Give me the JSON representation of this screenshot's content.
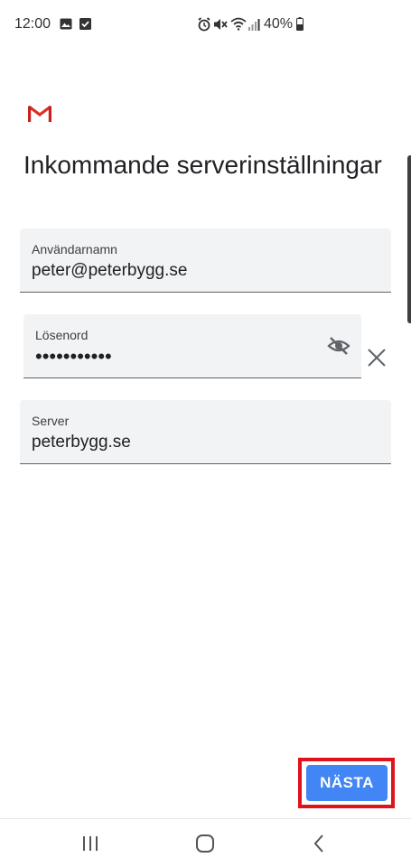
{
  "status_bar": {
    "time": "12:00",
    "battery": "40%",
    "left_icons": [
      "image-icon",
      "check-square-icon"
    ],
    "right_icons": [
      "alarm-icon",
      "mute-icon",
      "wifi-icon",
      "signal-icon",
      "battery-icon"
    ]
  },
  "app": {
    "logo": "gmail-logo",
    "title": "Inkommande serverinställningar"
  },
  "form": {
    "username": {
      "label": "Användarnamn",
      "value": "peter@peterbygg.se"
    },
    "password": {
      "label": "Lösenord",
      "value": "•••••••••••"
    },
    "server": {
      "label": "Server",
      "value": "peterbygg.se"
    }
  },
  "actions": {
    "next_label": "NÄSTA"
  },
  "colors": {
    "accent": "#4285f4",
    "highlight": "#e0121c",
    "field_bg": "#f1f3f4"
  },
  "nav": {
    "icons": [
      "recent-apps-icon",
      "home-icon",
      "back-icon"
    ]
  }
}
